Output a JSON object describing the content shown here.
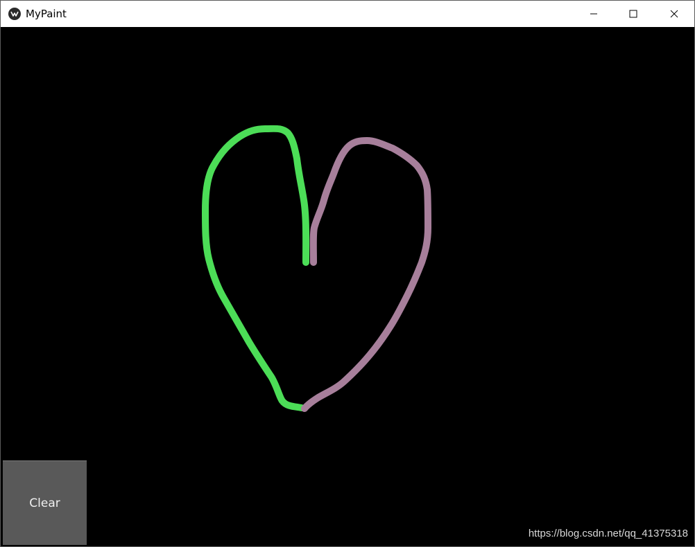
{
  "window": {
    "title": "MyPaint",
    "controls": {
      "minimize": "minimize-icon",
      "maximize": "maximize-icon",
      "close": "close-icon"
    }
  },
  "canvas": {
    "background_color": "#000000",
    "strokes": [
      {
        "name": "green-stroke",
        "color": "#4cdd57"
      },
      {
        "name": "mauve-stroke",
        "color": "#a77f9b"
      }
    ]
  },
  "toolbar": {
    "clear_label": "Clear",
    "clear_color": "#595959"
  },
  "watermark": {
    "text": "https://blog.csdn.net/qq_41375318"
  }
}
